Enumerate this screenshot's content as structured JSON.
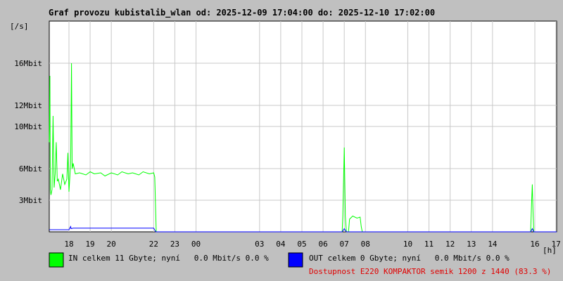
{
  "header": {
    "title": "Graf provozu kubistalib_wlan od: 2025-12-09 17:04:00 do: 2025-12-10 17:02:00",
    "y_unit": "[/s]",
    "x_unit": "[h]"
  },
  "legend": {
    "in": {
      "color": "#00ff00",
      "text": "IN celkem 11 Gbyte; nyní   0.0 Mbit/s 0.0 %"
    },
    "out": {
      "color": "#0000ff",
      "text": "OUT celkem 0 Gbyte; nyní   0.0 Mbit/s 0.0 %"
    },
    "availability": {
      "color": "#e00000",
      "text": "Dostupnost E220 KOMPAKTOR semik 1200 z 1440 (83.3 %)"
    }
  },
  "chart_data": {
    "type": "line",
    "x_unit": "h",
    "y_unit": "Mbit/s",
    "ylim": [
      0,
      20
    ],
    "xlim": [
      17.07,
      41.03
    ],
    "grid": true,
    "y_ticks": [
      {
        "value": 3,
        "label": "3Mbit"
      },
      {
        "value": 6,
        "label": "6Mbit"
      },
      {
        "value": 10,
        "label": "10Mbit"
      },
      {
        "value": 12,
        "label": "12Mbit"
      },
      {
        "value": 16,
        "label": "16Mbit"
      }
    ],
    "x_ticks": [
      {
        "value": 18,
        "label": "18"
      },
      {
        "value": 19,
        "label": "19"
      },
      {
        "value": 20,
        "label": "20"
      },
      {
        "value": 22,
        "label": "22"
      },
      {
        "value": 23,
        "label": "23"
      },
      {
        "value": 24,
        "label": "00"
      },
      {
        "value": 27,
        "label": "03"
      },
      {
        "value": 28,
        "label": "04"
      },
      {
        "value": 29,
        "label": "05"
      },
      {
        "value": 30,
        "label": "06"
      },
      {
        "value": 31,
        "label": "07"
      },
      {
        "value": 32,
        "label": "08"
      },
      {
        "value": 34,
        "label": "10"
      },
      {
        "value": 35,
        "label": "11"
      },
      {
        "value": 36,
        "label": "12"
      },
      {
        "value": 37,
        "label": "13"
      },
      {
        "value": 38,
        "label": "14"
      },
      {
        "value": 40,
        "label": "16"
      },
      {
        "value": 41,
        "label": "17"
      }
    ],
    "series": [
      {
        "color": "#00ff00",
        "points": [
          [
            17.07,
            8.5
          ],
          [
            17.1,
            14.8
          ],
          [
            17.12,
            4.0
          ],
          [
            17.15,
            3.5
          ],
          [
            17.2,
            4.0
          ],
          [
            17.25,
            11.0
          ],
          [
            17.3,
            4.2
          ],
          [
            17.35,
            5.5
          ],
          [
            17.4,
            8.5
          ],
          [
            17.45,
            4.8
          ],
          [
            17.5,
            5.0
          ],
          [
            17.55,
            4.5
          ],
          [
            17.6,
            4.0
          ],
          [
            17.7,
            5.5
          ],
          [
            17.8,
            4.5
          ],
          [
            17.9,
            5.0
          ],
          [
            17.95,
            7.5
          ],
          [
            18.0,
            3.8
          ],
          [
            18.05,
            5.5
          ],
          [
            18.08,
            6.5
          ],
          [
            18.12,
            16.0
          ],
          [
            18.15,
            6.0
          ],
          [
            18.2,
            6.5
          ],
          [
            18.3,
            5.5
          ],
          [
            18.5,
            5.6
          ],
          [
            18.8,
            5.4
          ],
          [
            19.0,
            5.7
          ],
          [
            19.2,
            5.5
          ],
          [
            19.5,
            5.6
          ],
          [
            19.7,
            5.3
          ],
          [
            20.0,
            5.6
          ],
          [
            20.3,
            5.4
          ],
          [
            20.5,
            5.7
          ],
          [
            20.8,
            5.5
          ],
          [
            21.0,
            5.6
          ],
          [
            21.3,
            5.4
          ],
          [
            21.5,
            5.7
          ],
          [
            21.8,
            5.5
          ],
          [
            22.0,
            5.6
          ],
          [
            22.05,
            5.2
          ],
          [
            22.1,
            1.5
          ],
          [
            22.12,
            0
          ],
          [
            30.9,
            0
          ],
          [
            30.93,
            1.5
          ],
          [
            31.0,
            8.0
          ],
          [
            31.05,
            1.5
          ],
          [
            31.1,
            0
          ],
          [
            31.2,
            0
          ],
          [
            31.25,
            1.2
          ],
          [
            31.4,
            1.5
          ],
          [
            31.6,
            1.3
          ],
          [
            31.75,
            1.4
          ],
          [
            31.8,
            0.5
          ],
          [
            31.85,
            0
          ],
          [
            39.8,
            0
          ],
          [
            39.85,
            3.0
          ],
          [
            39.88,
            4.5
          ],
          [
            39.92,
            1.5
          ],
          [
            39.95,
            0
          ],
          [
            41.03,
            0
          ]
        ]
      },
      {
        "color": "#0000ff",
        "points": [
          [
            17.07,
            0.2
          ],
          [
            18.0,
            0.2
          ],
          [
            18.08,
            0.5
          ],
          [
            18.1,
            0.3
          ],
          [
            18.2,
            0.35
          ],
          [
            22.0,
            0.35
          ],
          [
            22.1,
            0
          ],
          [
            30.9,
            0
          ],
          [
            31.0,
            0.3
          ],
          [
            31.1,
            0
          ],
          [
            39.8,
            0
          ],
          [
            39.88,
            0.3
          ],
          [
            39.95,
            0
          ],
          [
            41.03,
            0
          ]
        ]
      }
    ]
  }
}
